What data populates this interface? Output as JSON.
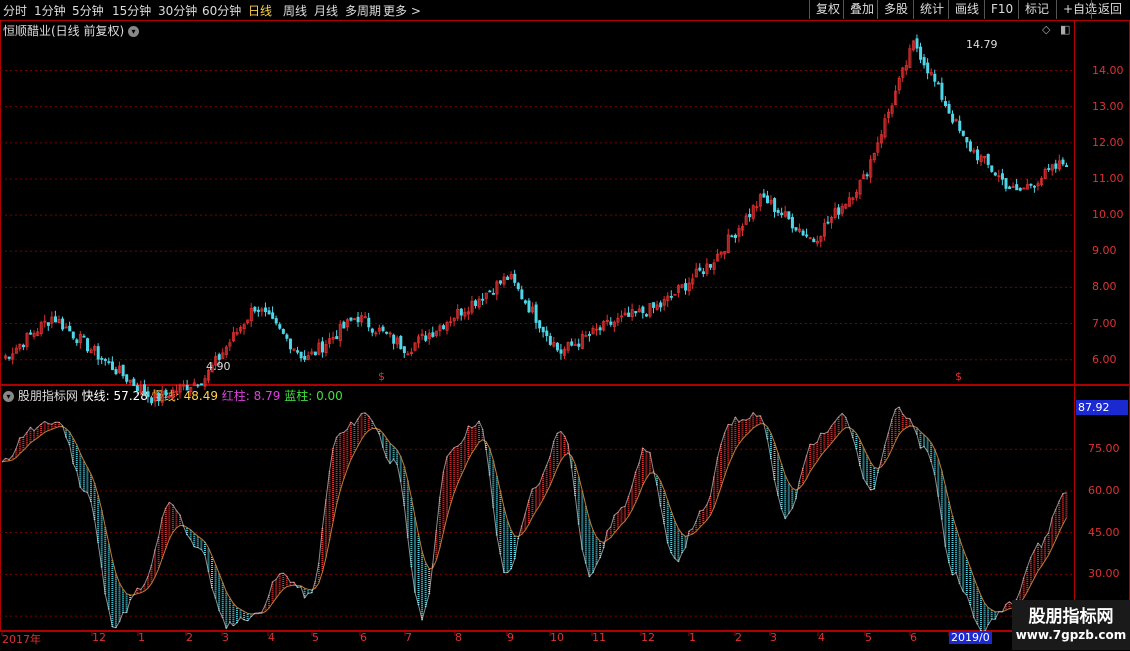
{
  "toolbar": {
    "periods": [
      "分时",
      "1分钟",
      "5分钟",
      "15分钟",
      "30分钟",
      "60分钟",
      "日线",
      "周线",
      "月线",
      "多周期",
      "更多 >"
    ],
    "active_period": "日线",
    "actions": [
      "复权",
      "叠加",
      "多股",
      "统计",
      "画线",
      "F10",
      "标记",
      "+自选",
      "返回"
    ]
  },
  "main_panel": {
    "title": "恒顺醋业(日线 前复权)",
    "high_label": "14.79",
    "low_label": "4.90",
    "axis_labels": [
      "14.00",
      "13.00",
      "12.00",
      "11.00",
      "10.00",
      "9.00",
      "8.00",
      "7.00",
      "6.00"
    ],
    "s_marker": "$"
  },
  "indicator_panel": {
    "name": "股朋指标网",
    "fast_label": "快线:",
    "fast_value": "57.28",
    "slow_label": "慢线:",
    "slow_value": "48.49",
    "red_label": "红柱:",
    "red_value": "8.79",
    "blue_label": "蓝柱:",
    "blue_value": "0.00",
    "current_tag": "87.92",
    "axis_labels": [
      "75.00",
      "60.00",
      "45.00",
      "30.00",
      "15.00"
    ]
  },
  "time_axis": {
    "labels": [
      "2017年",
      "12",
      "1",
      "2",
      "3",
      "4",
      "5",
      "6",
      "7",
      "8",
      "9",
      "10",
      "11",
      "12",
      "1",
      "2",
      "3",
      "4",
      "5",
      "6",
      "2019/0"
    ]
  },
  "watermark": {
    "title": "股朋指标网",
    "url": "www.7gpzb.com"
  },
  "colors": {
    "up": "#e03030",
    "down": "#4fd6e8",
    "grid": "#7a0000",
    "fast_line": "#ffffff",
    "slow_line": "#ffd24a",
    "red_bar": "#e03030",
    "blue_bar": "#4fd6e8"
  },
  "chart_data": [
    {
      "type": "candlestick",
      "title": "恒顺醋业(日线 前复权)",
      "ylim": [
        5.3,
        14.9
      ],
      "yticks": [
        6,
        7,
        8,
        9,
        10,
        11,
        12,
        13,
        14
      ],
      "close_keypoints": [
        {
          "x": "2017-11",
          "y": 6.0
        },
        {
          "x": "2017-12",
          "y": 7.2
        },
        {
          "x": "2018-01",
          "y": 6.0
        },
        {
          "x": "2018-02",
          "y": 4.9
        },
        {
          "x": "2018-03",
          "y": 5.5
        },
        {
          "x": "2018-04",
          "y": 7.5
        },
        {
          "x": "2018-05",
          "y": 6.0
        },
        {
          "x": "2018-06",
          "y": 7.2
        },
        {
          "x": "2018-07",
          "y": 6.3
        },
        {
          "x": "2018-08",
          "y": 7.3
        },
        {
          "x": "2018-09",
          "y": 8.3
        },
        {
          "x": "2018-10",
          "y": 6.2
        },
        {
          "x": "2018-11",
          "y": 7.0
        },
        {
          "x": "2018-12",
          "y": 7.5
        },
        {
          "x": "2019-01",
          "y": 8.7
        },
        {
          "x": "2019-02",
          "y": 10.5
        },
        {
          "x": "2019-03",
          "y": 9.3
        },
        {
          "x": "2019-04",
          "y": 11.0
        },
        {
          "x": "2019-05",
          "y": 14.79
        },
        {
          "x": "2019-06",
          "y": 12.0
        },
        {
          "x": "2019-07",
          "y": 10.6
        },
        {
          "x": "2019-08",
          "y": 11.5
        }
      ],
      "annotations": [
        {
          "label": "14.79",
          "type": "max"
        },
        {
          "label": "4.90",
          "type": "min"
        }
      ]
    },
    {
      "type": "line",
      "title": "股朋指标网",
      "ylim": [
        10,
        92
      ],
      "yticks": [
        15,
        30,
        45,
        60,
        75
      ],
      "series": [
        {
          "name": "快线",
          "last": 57.28
        },
        {
          "name": "慢线",
          "last": 48.49
        },
        {
          "name": "红柱",
          "last": 8.79
        },
        {
          "name": "蓝柱",
          "last": 0.0
        }
      ],
      "fast_keypoints": [
        70,
        82,
        85,
        60,
        12,
        25,
        55,
        40,
        12,
        15,
        30,
        22,
        80,
        88,
        70,
        15,
        75,
        85,
        30,
        60,
        82,
        30,
        52,
        75,
        35,
        52,
        85,
        88,
        50,
        78,
        88,
        60,
        90,
        75,
        30,
        10,
        20,
        40,
        60
      ]
    }
  ]
}
